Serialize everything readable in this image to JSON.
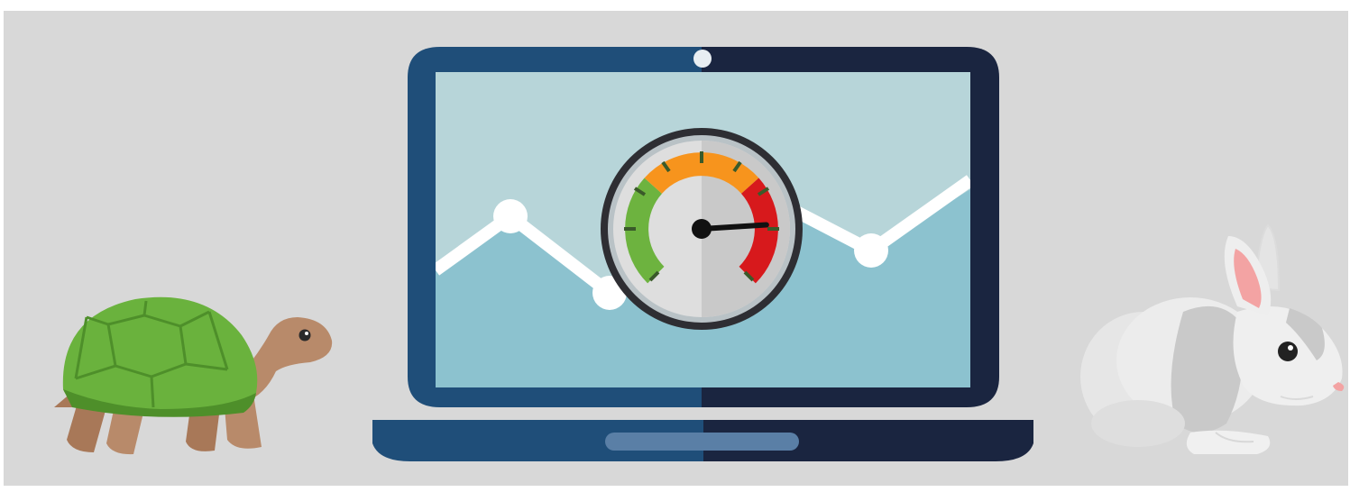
{
  "scene": {
    "subject": "speed-comparison-illustration",
    "left_character": "turtle-icon",
    "right_character": "rabbit-icon",
    "center_object": "laptop-icon",
    "screen_content": [
      "line-graph",
      "speedometer-icon"
    ]
  },
  "gauge": {
    "needle_level": 0.82,
    "zones": [
      {
        "name": "slow",
        "color": "#6db33f"
      },
      {
        "name": "medium",
        "color": "#f7941d"
      },
      {
        "name": "fast",
        "color": "#d7191c"
      }
    ]
  },
  "colors": {
    "background": "#d8d8d8",
    "laptop_left": "#1f4e79",
    "laptop_right": "#1a2540",
    "screen_top": "#b7d5d9",
    "screen_bottom": "#8cc2cf",
    "graph_line": "#ffffff",
    "turtle_shell": "#6ab23d",
    "turtle_skin": "#b88a6a",
    "rabbit_fur": "#ebebeb",
    "rabbit_ear": "#f3a3a3"
  }
}
